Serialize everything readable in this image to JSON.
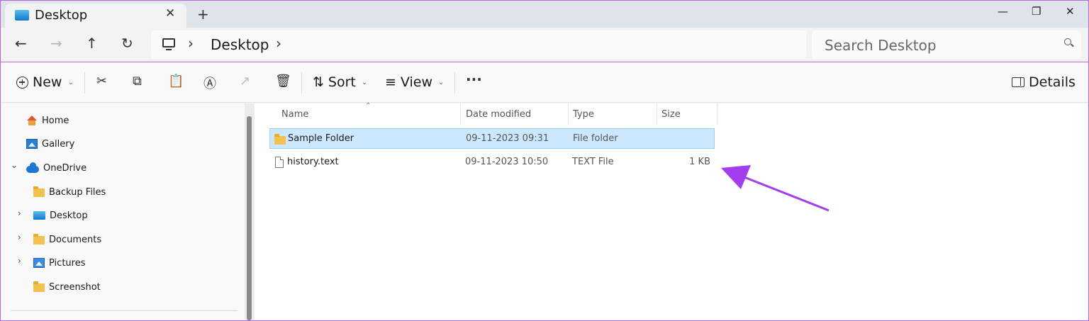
{
  "window": {
    "tab_title": "Desktop",
    "tab_close": "✕",
    "new_tab": "+",
    "minimize": "—",
    "maximize": "❐",
    "close": "✕"
  },
  "nav": {
    "back": "←",
    "forward": "→",
    "up": "↑",
    "refresh": "↻",
    "chevron": "›",
    "breadcrumb": "Desktop",
    "search_placeholder": "Search Desktop"
  },
  "commandbar": {
    "new_label": "New",
    "sort_label": "Sort",
    "view_label": "View",
    "more_label": "···",
    "details_label": "Details",
    "cut": "✂",
    "copy": "⧉",
    "paste": "📋",
    "rename": "Ⓐ",
    "share": "↗",
    "delete": "🗑",
    "sort_icon": "⇅",
    "view_icon": "≡"
  },
  "sidebar": {
    "items": [
      {
        "label": "Home",
        "icon": "home-icon"
      },
      {
        "label": "Gallery",
        "icon": "gallery-icon"
      },
      {
        "label": "OneDrive",
        "icon": "cloud-icon"
      },
      {
        "label": "Backup Files",
        "icon": "folder-icon"
      },
      {
        "label": "Desktop",
        "icon": "desktop-icon"
      },
      {
        "label": "Documents",
        "icon": "folder-icon"
      },
      {
        "label": "Pictures",
        "icon": "pictures-icon"
      },
      {
        "label": "Screenshot",
        "icon": "folder-icon"
      }
    ],
    "expand_open": "⌄",
    "expand_closed": "›"
  },
  "table": {
    "columns": [
      "Name",
      "Date modified",
      "Type",
      "Size"
    ],
    "sort_indicator": "⌃",
    "rows": [
      {
        "name": "Sample Folder",
        "date": "09-11-2023 09:31",
        "type": "File folder",
        "size": "",
        "icon": "folder-icon",
        "selected": true
      },
      {
        "name": "history.text",
        "date": "09-11-2023 10:50",
        "type": "TEXT File",
        "size": "1 KB",
        "icon": "file-icon",
        "selected": false
      }
    ]
  },
  "colors": {
    "accent_border": "#b46ad9",
    "annotation_arrow": "#a33df0",
    "selection_bg": "#cce8ff"
  }
}
